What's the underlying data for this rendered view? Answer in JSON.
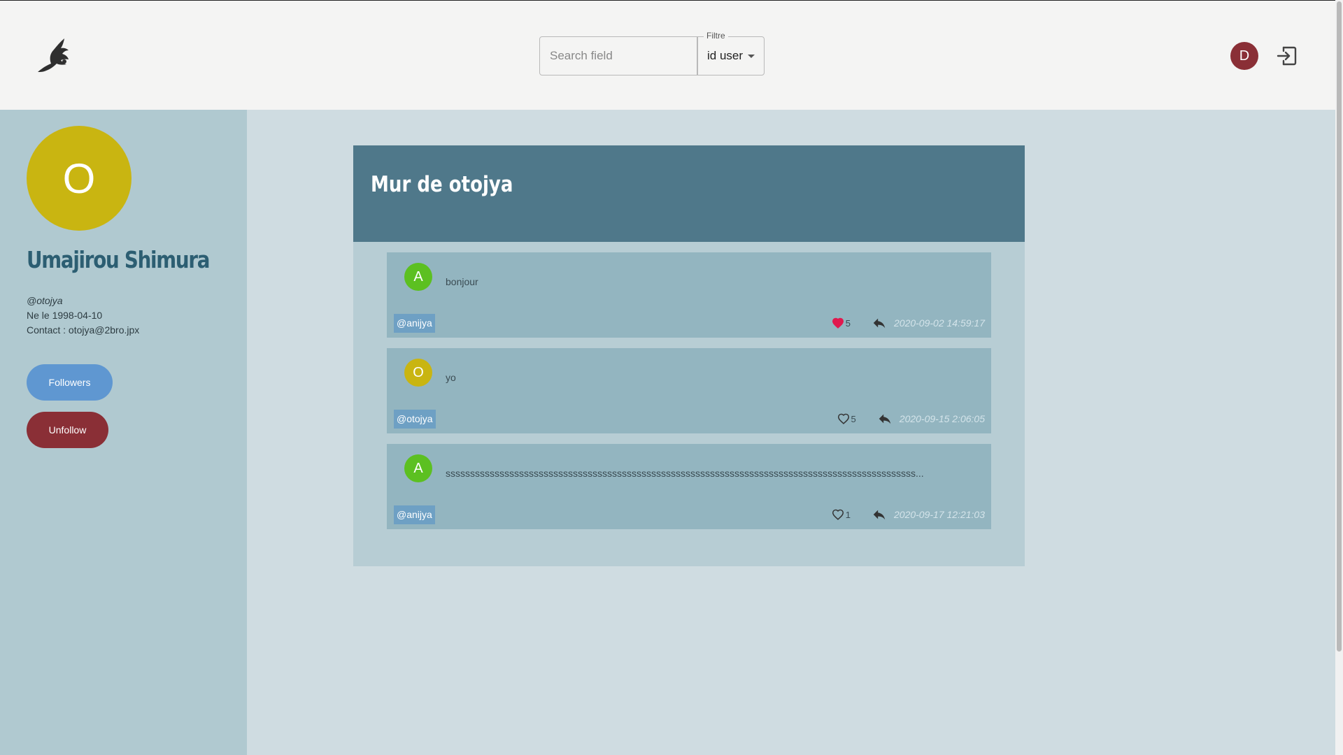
{
  "header": {
    "search_placeholder": "Search field",
    "filter_label": "Filtre",
    "filter_value": "id user",
    "user_initial": "D"
  },
  "profile": {
    "initial": "O",
    "name": "Umajirou Shimura",
    "handle": "@otojya",
    "birth": "Ne le 1998-04-10",
    "contact": "Contact : otojya@2bro.jpx",
    "followers_label": "Followers",
    "unfollow_label": "Unfollow"
  },
  "wall": {
    "title": "Mur de otojya",
    "posts": [
      {
        "initial": "A",
        "text": "bonjour",
        "handle": "@anijya",
        "likes": "5",
        "liked": true,
        "date": "2020-09-02 14:59:17",
        "avatar_color": "#5cc021"
      },
      {
        "initial": "O",
        "text": "yo",
        "handle": "@otojya",
        "likes": "5",
        "liked": false,
        "date": "2020-09-15 2:06:05",
        "avatar_color": "#c9b511"
      },
      {
        "initial": "A",
        "text": "ssssssssssssssssssssssssssssssssssssssssssssssssssssssssssssssssssssssssssssssssssssssssssssssss...",
        "handle": "@anijya",
        "likes": "1",
        "liked": false,
        "date": "2020-09-17 12:21:03",
        "avatar_color": "#5cc021"
      }
    ]
  },
  "colors": {
    "header_bg": "#f4f4f3",
    "sidebar_bg": "#b0c9d0",
    "wall_header": "#4f788a",
    "followers_button": "#5f97d1",
    "unfollow_button": "#8a2f36",
    "liked_heart": "#e0194e"
  },
  "icons": {
    "logo": "eagle-logo-icon",
    "logout": "logout-icon",
    "like": "heart-icon",
    "reply": "reply-icon"
  }
}
